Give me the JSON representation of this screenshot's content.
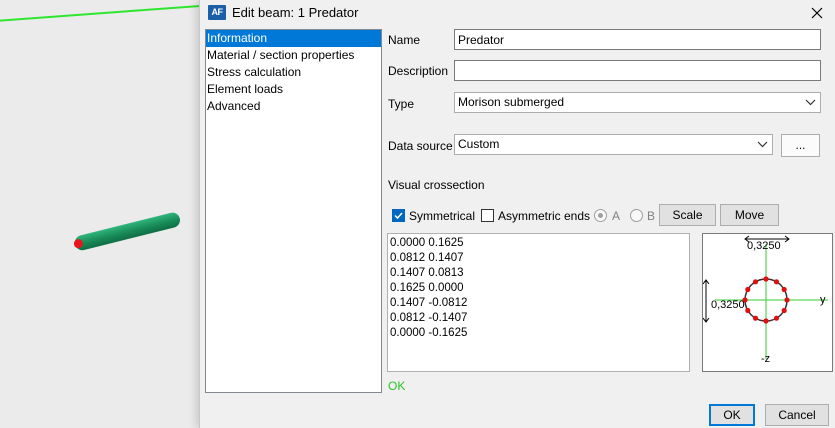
{
  "dialog": {
    "title": "Edit beam: 1 Predator",
    "app_icon_text": "AF"
  },
  "nav": {
    "items": [
      {
        "label": "Information",
        "selected": true
      },
      {
        "label": "Material / section properties",
        "selected": false
      },
      {
        "label": "Stress calculation",
        "selected": false
      },
      {
        "label": "Element loads",
        "selected": false
      },
      {
        "label": "Advanced",
        "selected": false
      }
    ]
  },
  "form": {
    "name_label": "Name",
    "name_value": "Predator",
    "description_label": "Description",
    "description_value": "",
    "type_label": "Type",
    "type_value": "Morison submerged",
    "datasource_label": "Data source",
    "datasource_value": "Custom",
    "browse_label": "...",
    "visual_label": "Visual crossection"
  },
  "options": {
    "symmetrical_label": "Symmetrical",
    "symmetrical_checked": true,
    "asymmetric_label": "Asymmetric ends",
    "asymmetric_checked": false,
    "radio_a_label": "A",
    "radio_b_label": "B",
    "scale_label": "Scale",
    "move_label": "Move"
  },
  "coordinates": [
    "0.0000 0.1625",
    "0.0812 0.1407",
    "0.1407 0.0813",
    "0.1625 0.0000",
    "0.1407 -0.0812",
    "0.0812 -0.1407",
    "0.0000 -0.1625"
  ],
  "preview": {
    "width_label": "0,3250",
    "height_label": "0,3250",
    "y_axis_label": "y",
    "z_axis_label": "-z",
    "point_color": "#e01010",
    "circle_color": "#333333",
    "axis_color": "#33cc33"
  },
  "status": {
    "text": "OK",
    "color": "#28c428"
  },
  "buttons": {
    "ok_label": "OK",
    "cancel_label": "Cancel"
  }
}
